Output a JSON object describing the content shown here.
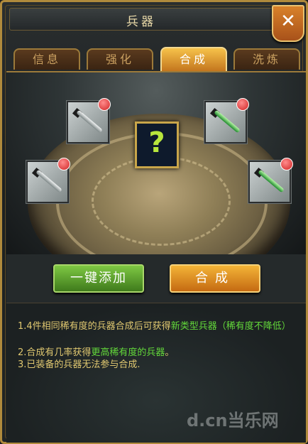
{
  "window": {
    "title": "兵器",
    "close_icon": "close-icon"
  },
  "tabs": [
    {
      "label": "信息",
      "active": false
    },
    {
      "label": "强化",
      "active": false
    },
    {
      "label": "合成",
      "active": true
    },
    {
      "label": "洗炼",
      "active": false
    }
  ],
  "slots": {
    "result_icon": "question-mark-icon",
    "result_label": "?",
    "weapon_icons": [
      "sword-icon",
      "jade-sword-icon",
      "spear-icon",
      "jade-blade-icon"
    ]
  },
  "buttons": {
    "auto_add": "一键添加",
    "compose": "合成"
  },
  "info": {
    "line1_a": "1.4件相同稀有度的兵器合成后可获得",
    "line1_b": "新类型兵器",
    "line1_c": "（稀有度不降低）",
    "line2_a": "2.合成有几率获得",
    "line2_b": "更高稀有度的兵器",
    "line2_c": "。",
    "line3": "3.已装备的兵器无法参与合成."
  },
  "watermark": "d.cn当乐网",
  "colors": {
    "accent_gold": "#c9a64a",
    "tab_active": "#f6c24a",
    "green_button": "#5aa52e",
    "orange_button": "#e08a22",
    "highlight_green": "#63d83a",
    "text_gold": "#e0c870"
  }
}
